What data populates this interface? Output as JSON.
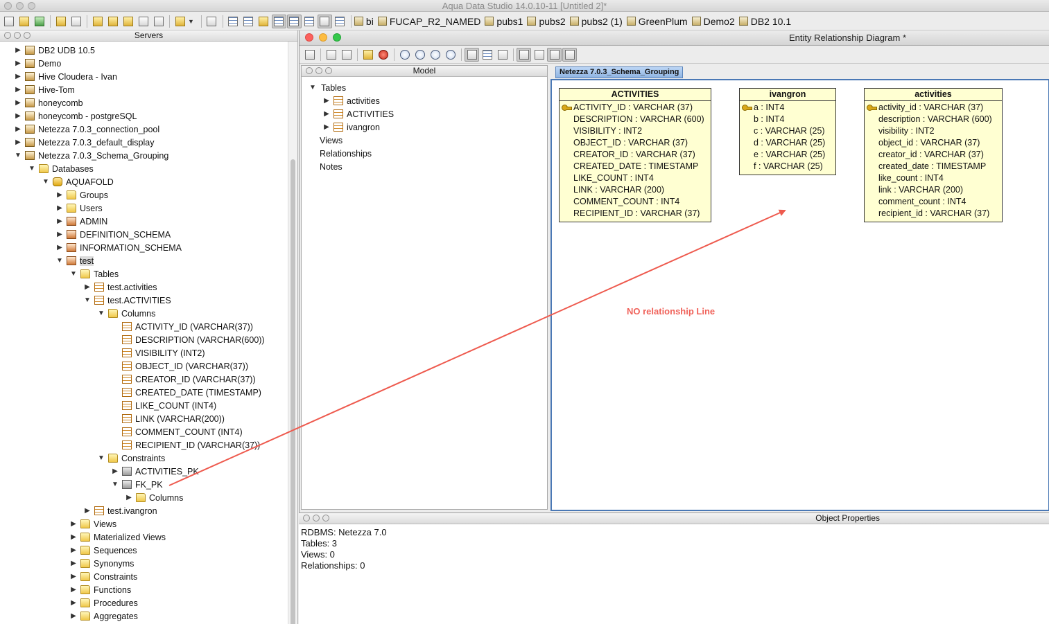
{
  "app": {
    "title": "Aqua Data Studio 14.0.10-11 [Untitled 2]*"
  },
  "toolbar": {
    "servers": [
      "bi",
      "FUCAP_R2_NAMED",
      "pubs1",
      "pubs2",
      "pubs2 (1)",
      "GreenPlum",
      "Demo2",
      "DB2 10.1"
    ]
  },
  "servers_panel": {
    "title": "Servers",
    "nodes": [
      {
        "label": "DB2 UDB 10.5",
        "icon": "server-icon",
        "arrow": "▶"
      },
      {
        "label": "Demo",
        "icon": "server-icon",
        "arrow": "▶"
      },
      {
        "label": "Hive Cloudera - Ivan",
        "icon": "server-icon",
        "arrow": "▶"
      },
      {
        "label": "Hive-Tom",
        "icon": "server-icon",
        "arrow": "▶"
      },
      {
        "label": "honeycomb",
        "icon": "server-icon",
        "arrow": "▶"
      },
      {
        "label": "honeycomb - postgreSQL",
        "icon": "server-icon",
        "arrow": "▶"
      },
      {
        "label": "Netezza 7.0.3_connection_pool",
        "icon": "server-icon",
        "arrow": "▶"
      },
      {
        "label": "Netezza 7.0.3_default_display",
        "icon": "server-icon",
        "arrow": "▶"
      },
      {
        "label": "Netezza 7.0.3_Schema_Grouping",
        "icon": "server-icon",
        "arrow": "▼"
      },
      {
        "label": "Databases",
        "icon": "folder-icon",
        "arrow": "▼"
      },
      {
        "label": "AQUAFOLD",
        "icon": "database-icon",
        "arrow": "▼"
      },
      {
        "label": "Groups",
        "icon": "folder-icon",
        "arrow": "▶"
      },
      {
        "label": "Users",
        "icon": "folder-icon",
        "arrow": "▶"
      },
      {
        "label": "ADMIN",
        "icon": "schema-icon",
        "arrow": "▶"
      },
      {
        "label": "DEFINITION_SCHEMA",
        "icon": "schema-icon",
        "arrow": "▶"
      },
      {
        "label": "INFORMATION_SCHEMA",
        "icon": "schema-icon",
        "arrow": "▶"
      },
      {
        "label": "test",
        "icon": "schema-icon",
        "arrow": "▼"
      },
      {
        "label": "Tables",
        "icon": "folder-icon",
        "arrow": "▼"
      },
      {
        "label": "test.activities",
        "icon": "table-icon",
        "arrow": "▶"
      },
      {
        "label": "test.ACTIVITIES",
        "icon": "table-icon",
        "arrow": "▼"
      },
      {
        "label": "Columns",
        "icon": "folder-icon",
        "arrow": "▼"
      },
      {
        "label": "ACTIVITY_ID (VARCHAR(37))",
        "icon": "column-icon",
        "arrow": ""
      },
      {
        "label": "DESCRIPTION (VARCHAR(600))",
        "icon": "column-icon",
        "arrow": ""
      },
      {
        "label": "VISIBILITY (INT2)",
        "icon": "column-icon",
        "arrow": ""
      },
      {
        "label": "OBJECT_ID (VARCHAR(37))",
        "icon": "column-icon",
        "arrow": ""
      },
      {
        "label": "CREATOR_ID (VARCHAR(37))",
        "icon": "column-icon",
        "arrow": ""
      },
      {
        "label": "CREATED_DATE (TIMESTAMP)",
        "icon": "column-icon",
        "arrow": ""
      },
      {
        "label": "LIKE_COUNT (INT4)",
        "icon": "column-icon",
        "arrow": ""
      },
      {
        "label": "LINK (VARCHAR(200))",
        "icon": "column-icon",
        "arrow": ""
      },
      {
        "label": "COMMENT_COUNT (INT4)",
        "icon": "column-icon",
        "arrow": ""
      },
      {
        "label": "RECIPIENT_ID (VARCHAR(37))",
        "icon": "column-icon",
        "arrow": ""
      },
      {
        "label": "Constraints",
        "icon": "folder-icon",
        "arrow": "▼"
      },
      {
        "label": "ACTIVITIES_PK",
        "icon": "constraint-icon",
        "arrow": "▶"
      },
      {
        "label": "FK_PK",
        "icon": "constraint-icon",
        "arrow": "▼"
      },
      {
        "label": "Columns",
        "icon": "folder-icon",
        "arrow": "▶"
      },
      {
        "label": "test.ivangron",
        "icon": "table-icon",
        "arrow": "▶"
      },
      {
        "label": "Views",
        "icon": "folder-icon",
        "arrow": "▶"
      },
      {
        "label": "Materialized Views",
        "icon": "folder-icon",
        "arrow": "▶"
      },
      {
        "label": "Sequences",
        "icon": "folder-icon",
        "arrow": "▶"
      },
      {
        "label": "Synonyms",
        "icon": "folder-icon",
        "arrow": "▶"
      },
      {
        "label": "Constraints",
        "icon": "folder-icon",
        "arrow": "▶"
      },
      {
        "label": "Functions",
        "icon": "folder-icon",
        "arrow": "▶"
      },
      {
        "label": "Procedures",
        "icon": "folder-icon",
        "arrow": "▶"
      },
      {
        "label": "Aggregates",
        "icon": "folder-icon",
        "arrow": "▶"
      }
    ]
  },
  "erd": {
    "title": "Entity Relationship Diagram *",
    "model_panel": {
      "title": "Model",
      "items": [
        {
          "label": "Tables",
          "arrow": "▼",
          "icon": ""
        },
        {
          "label": "activities",
          "arrow": "▶",
          "icon": "table-icon"
        },
        {
          "label": "ACTIVITIES",
          "arrow": "▶",
          "icon": "table-icon"
        },
        {
          "label": "ivangron",
          "arrow": "▶",
          "icon": "table-icon"
        },
        {
          "label": "Views",
          "arrow": "",
          "icon": ""
        },
        {
          "label": "Relationships",
          "arrow": "",
          "icon": ""
        },
        {
          "label": "Notes",
          "arrow": "",
          "icon": ""
        }
      ]
    },
    "canvas_tab": "Netezza 7.0.3_Schema_Grouping",
    "entities": [
      {
        "name": "ACTIVITIES",
        "rows": [
          {
            "text": "ACTIVITY_ID : VARCHAR (37)",
            "key": true
          },
          {
            "text": "DESCRIPTION : VARCHAR (600)",
            "key": false
          },
          {
            "text": "VISIBILITY : INT2",
            "key": false
          },
          {
            "text": "OBJECT_ID : VARCHAR (37)",
            "key": false
          },
          {
            "text": "CREATOR_ID : VARCHAR (37)",
            "key": false
          },
          {
            "text": "CREATED_DATE : TIMESTAMP",
            "key": false
          },
          {
            "text": "LIKE_COUNT : INT4",
            "key": false
          },
          {
            "text": "LINK : VARCHAR (200)",
            "key": false
          },
          {
            "text": "COMMENT_COUNT : INT4",
            "key": false
          },
          {
            "text": "RECIPIENT_ID : VARCHAR (37)",
            "key": false
          }
        ]
      },
      {
        "name": "ivangron",
        "rows": [
          {
            "text": "a : INT4",
            "key": true
          },
          {
            "text": "b : INT4",
            "key": false
          },
          {
            "text": "c : VARCHAR (25)",
            "key": false
          },
          {
            "text": "d : VARCHAR (25)",
            "key": false
          },
          {
            "text": "e : VARCHAR (25)",
            "key": false
          },
          {
            "text": "f : VARCHAR (25)",
            "key": false
          }
        ]
      },
      {
        "name": "activities",
        "rows": [
          {
            "text": "activity_id : VARCHAR (37)",
            "key": true
          },
          {
            "text": "description : VARCHAR (600)",
            "key": false
          },
          {
            "text": "visibility : INT2",
            "key": false
          },
          {
            "text": "object_id : VARCHAR (37)",
            "key": false
          },
          {
            "text": "creator_id : VARCHAR (37)",
            "key": false
          },
          {
            "text": "created_date : TIMESTAMP",
            "key": false
          },
          {
            "text": "like_count : INT4",
            "key": false
          },
          {
            "text": "link : VARCHAR (200)",
            "key": false
          },
          {
            "text": "comment_count : INT4",
            "key": false
          },
          {
            "text": "recipient_id : VARCHAR (37)",
            "key": false
          }
        ]
      }
    ],
    "annotation": "NO relationship Line",
    "annotation_color": "#f0625a"
  },
  "object_properties": {
    "title": "Object Properties",
    "lines": [
      "RDBMS: Netezza 7.0",
      "Tables: 3",
      "Views: 0",
      "Relationships: 0"
    ]
  },
  "colors": {
    "entity_fill": "#ffffd2",
    "canvas_border": "#4a78b5",
    "tab_fill": "#9fc0e8"
  }
}
